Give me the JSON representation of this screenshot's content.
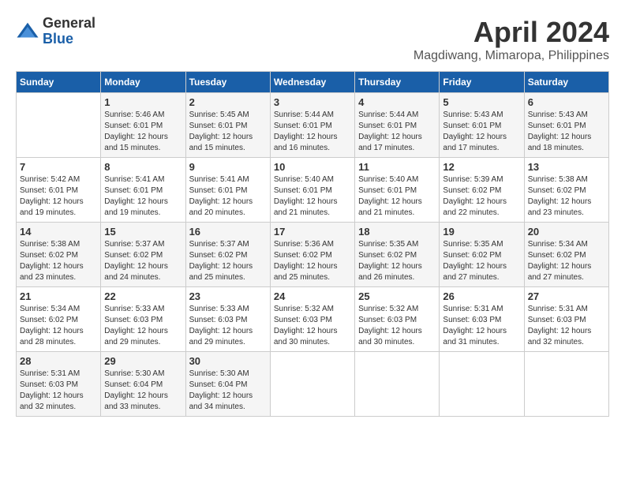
{
  "logo": {
    "general": "General",
    "blue": "Blue"
  },
  "title": "April 2024",
  "subtitle": "Magdiwang, Mimaropa, Philippines",
  "weekdays": [
    "Sunday",
    "Monday",
    "Tuesday",
    "Wednesday",
    "Thursday",
    "Friday",
    "Saturday"
  ],
  "weeks": [
    [
      {
        "day": "",
        "empty": true
      },
      {
        "day": "1",
        "sunrise": "5:46 AM",
        "sunset": "6:01 PM",
        "daylight": "12 hours and 15 minutes."
      },
      {
        "day": "2",
        "sunrise": "5:45 AM",
        "sunset": "6:01 PM",
        "daylight": "12 hours and 15 minutes."
      },
      {
        "day": "3",
        "sunrise": "5:44 AM",
        "sunset": "6:01 PM",
        "daylight": "12 hours and 16 minutes."
      },
      {
        "day": "4",
        "sunrise": "5:44 AM",
        "sunset": "6:01 PM",
        "daylight": "12 hours and 17 minutes."
      },
      {
        "day": "5",
        "sunrise": "5:43 AM",
        "sunset": "6:01 PM",
        "daylight": "12 hours and 17 minutes."
      },
      {
        "day": "6",
        "sunrise": "5:43 AM",
        "sunset": "6:01 PM",
        "daylight": "12 hours and 18 minutes."
      }
    ],
    [
      {
        "day": "7",
        "sunrise": "5:42 AM",
        "sunset": "6:01 PM",
        "daylight": "12 hours and 19 minutes."
      },
      {
        "day": "8",
        "sunrise": "5:41 AM",
        "sunset": "6:01 PM",
        "daylight": "12 hours and 19 minutes."
      },
      {
        "day": "9",
        "sunrise": "5:41 AM",
        "sunset": "6:01 PM",
        "daylight": "12 hours and 20 minutes."
      },
      {
        "day": "10",
        "sunrise": "5:40 AM",
        "sunset": "6:01 PM",
        "daylight": "12 hours and 21 minutes."
      },
      {
        "day": "11",
        "sunrise": "5:40 AM",
        "sunset": "6:01 PM",
        "daylight": "12 hours and 21 minutes."
      },
      {
        "day": "12",
        "sunrise": "5:39 AM",
        "sunset": "6:02 PM",
        "daylight": "12 hours and 22 minutes."
      },
      {
        "day": "13",
        "sunrise": "5:38 AM",
        "sunset": "6:02 PM",
        "daylight": "12 hours and 23 minutes."
      }
    ],
    [
      {
        "day": "14",
        "sunrise": "5:38 AM",
        "sunset": "6:02 PM",
        "daylight": "12 hours and 23 minutes."
      },
      {
        "day": "15",
        "sunrise": "5:37 AM",
        "sunset": "6:02 PM",
        "daylight": "12 hours and 24 minutes."
      },
      {
        "day": "16",
        "sunrise": "5:37 AM",
        "sunset": "6:02 PM",
        "daylight": "12 hours and 25 minutes."
      },
      {
        "day": "17",
        "sunrise": "5:36 AM",
        "sunset": "6:02 PM",
        "daylight": "12 hours and 25 minutes."
      },
      {
        "day": "18",
        "sunrise": "5:35 AM",
        "sunset": "6:02 PM",
        "daylight": "12 hours and 26 minutes."
      },
      {
        "day": "19",
        "sunrise": "5:35 AM",
        "sunset": "6:02 PM",
        "daylight": "12 hours and 27 minutes."
      },
      {
        "day": "20",
        "sunrise": "5:34 AM",
        "sunset": "6:02 PM",
        "daylight": "12 hours and 27 minutes."
      }
    ],
    [
      {
        "day": "21",
        "sunrise": "5:34 AM",
        "sunset": "6:02 PM",
        "daylight": "12 hours and 28 minutes."
      },
      {
        "day": "22",
        "sunrise": "5:33 AM",
        "sunset": "6:03 PM",
        "daylight": "12 hours and 29 minutes."
      },
      {
        "day": "23",
        "sunrise": "5:33 AM",
        "sunset": "6:03 PM",
        "daylight": "12 hours and 29 minutes."
      },
      {
        "day": "24",
        "sunrise": "5:32 AM",
        "sunset": "6:03 PM",
        "daylight": "12 hours and 30 minutes."
      },
      {
        "day": "25",
        "sunrise": "5:32 AM",
        "sunset": "6:03 PM",
        "daylight": "12 hours and 30 minutes."
      },
      {
        "day": "26",
        "sunrise": "5:31 AM",
        "sunset": "6:03 PM",
        "daylight": "12 hours and 31 minutes."
      },
      {
        "day": "27",
        "sunrise": "5:31 AM",
        "sunset": "6:03 PM",
        "daylight": "12 hours and 32 minutes."
      }
    ],
    [
      {
        "day": "28",
        "sunrise": "5:31 AM",
        "sunset": "6:03 PM",
        "daylight": "12 hours and 32 minutes."
      },
      {
        "day": "29",
        "sunrise": "5:30 AM",
        "sunset": "6:04 PM",
        "daylight": "12 hours and 33 minutes."
      },
      {
        "day": "30",
        "sunrise": "5:30 AM",
        "sunset": "6:04 PM",
        "daylight": "12 hours and 34 minutes."
      },
      {
        "day": "",
        "empty": true
      },
      {
        "day": "",
        "empty": true
      },
      {
        "day": "",
        "empty": true
      },
      {
        "day": "",
        "empty": true
      }
    ]
  ],
  "labels": {
    "sunrise": "Sunrise:",
    "sunset": "Sunset:",
    "daylight": "Daylight:"
  }
}
